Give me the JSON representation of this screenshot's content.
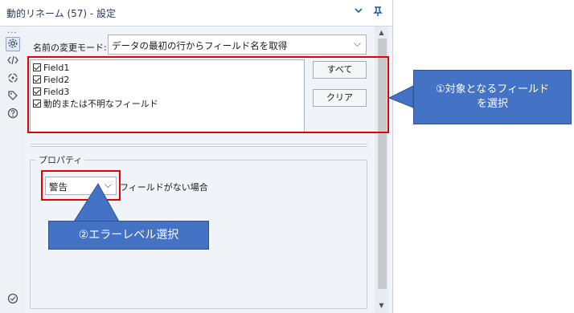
{
  "window": {
    "title": "動的リネーム (57) - 設定",
    "collapse_icon": "chevron-down-icon",
    "pin_icon": "pin-icon"
  },
  "sidebar": {
    "more_label": "...",
    "items": [
      {
        "name": "configuration",
        "icon": "gear-icon"
      },
      {
        "name": "code",
        "icon": "code-icon"
      },
      {
        "name": "connections",
        "icon": "connection-icon"
      },
      {
        "name": "annotation",
        "icon": "tag-icon"
      },
      {
        "name": "help",
        "icon": "help-icon"
      }
    ],
    "bottom_icon": "check-circle-icon"
  },
  "config": {
    "mode_label": "名前の変更モード:",
    "mode_value": "データの最初の行からフィールド名を取得",
    "fields": [
      {
        "label": "Field1",
        "checked": true
      },
      {
        "label": "Field2",
        "checked": true
      },
      {
        "label": "Field3",
        "checked": true
      },
      {
        "label": "動的または不明なフィールド",
        "checked": true
      }
    ],
    "select_all_label": "すべて",
    "clear_label": "クリア"
  },
  "properties": {
    "group_label": "プロパティ",
    "error_level_value": "警告",
    "error_level_label": "フィールドがない場合"
  },
  "annotations": {
    "callout1_line1": "①対象となるフィールド",
    "callout1_line2": "を選択",
    "callout2": "②エラーレベル選択",
    "highlight_color": "#e60000",
    "callout_color": "#4472c4"
  }
}
